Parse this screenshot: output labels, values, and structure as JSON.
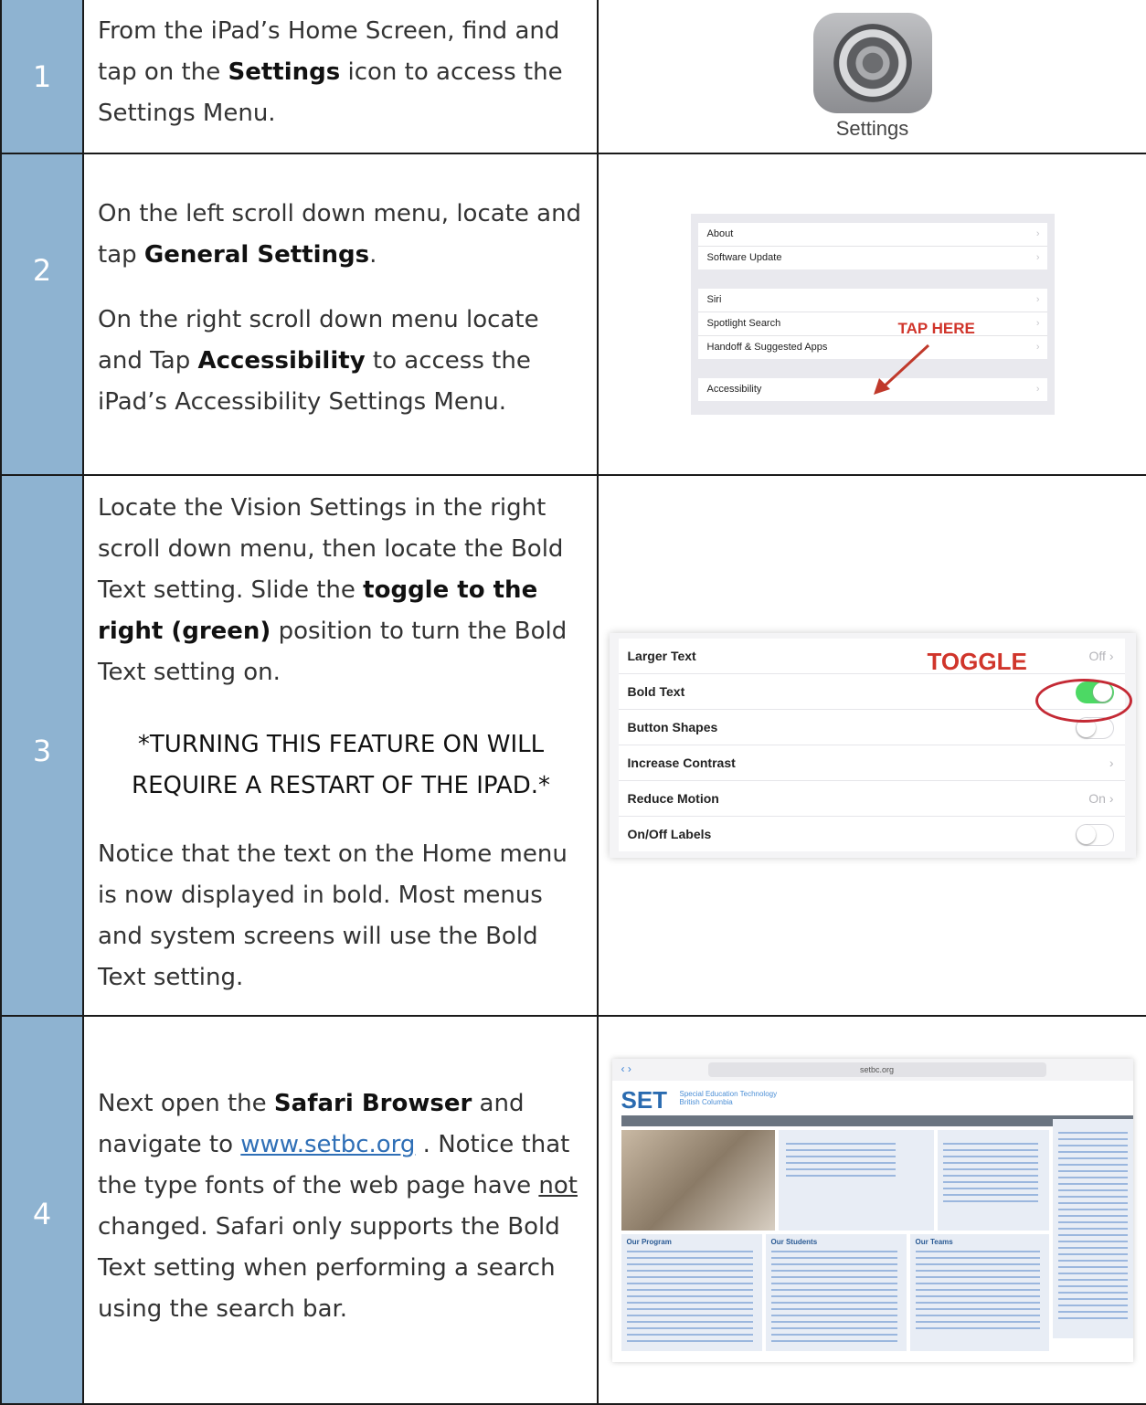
{
  "steps": [
    {
      "number": "1",
      "text": {
        "p1": "From the iPad’s Home Screen, find and tap on the ",
        "b1": "Settings",
        "p2": " icon to access the Settings Menu."
      },
      "image": {
        "label": "Settings",
        "icon": "settings-gear-icon"
      }
    },
    {
      "number": "2",
      "text": {
        "a1": "On the left scroll down menu, locate and tap ",
        "b1": "General Settings",
        "a2": ".",
        "c1": "On the right scroll down menu locate and Tap ",
        "b2": "Accessibility",
        "c2": " to access the iPad’s Accessibility Settings Menu."
      },
      "image": {
        "group1": [
          "About",
          "Software Update"
        ],
        "group2": [
          "Siri",
          "Spotlight Search",
          "Handoff & Suggested Apps"
        ],
        "group3": [
          "Accessibility"
        ],
        "annotation": "TAP HERE",
        "annotation_color": "#d0352b"
      }
    },
    {
      "number": "3",
      "text": {
        "a1": "Locate the Vision Settings in the right scroll down menu, then locate the Bold Text setting. Slide the ",
        "b1": "toggle to the right (green)",
        "a2": " position to turn the Bold Text setting on.",
        "warning": "*TURNING THIS FEATURE ON WILL REQUIRE A RESTART OF THE IPAD.*",
        "c1": "Notice that the text on the Home menu is now displayed in bold. Most menus and system screens will use the Bold Text setting."
      },
      "image": {
        "rows": [
          {
            "label": "Larger Text",
            "value": "Off ›"
          },
          {
            "label": "Bold Text",
            "toggle": "on"
          },
          {
            "label": "Button Shapes",
            "toggle": "off"
          },
          {
            "label": "Increase Contrast",
            "value": "›"
          },
          {
            "label": "Reduce Motion",
            "value": "On ›"
          },
          {
            "label": "On/Off Labels",
            "toggle": "off"
          }
        ],
        "annotation": "TOGGLE",
        "toggle_on_color": "#4cd964"
      }
    },
    {
      "number": "4",
      "text": {
        "a1": "Next open the ",
        "b1": "Safari Browser",
        "a2": " and navigate to ",
        "link": "www.setbc.org",
        "a3": " . Notice that the type fonts of the web page have ",
        "u1": "not",
        "a4": " changed. Safari only supports the Bold Text setting when performing a search using the search bar."
      },
      "image": {
        "url": "setbc.org",
        "logo": "SET",
        "logo_sub": "Special Education Technology British Columbia",
        "sections": [
          "Our Program",
          "Our Students",
          "Our Teams"
        ]
      }
    }
  ],
  "colors": {
    "number_column": "#8eb3d1",
    "link": "#2f6fb6"
  }
}
